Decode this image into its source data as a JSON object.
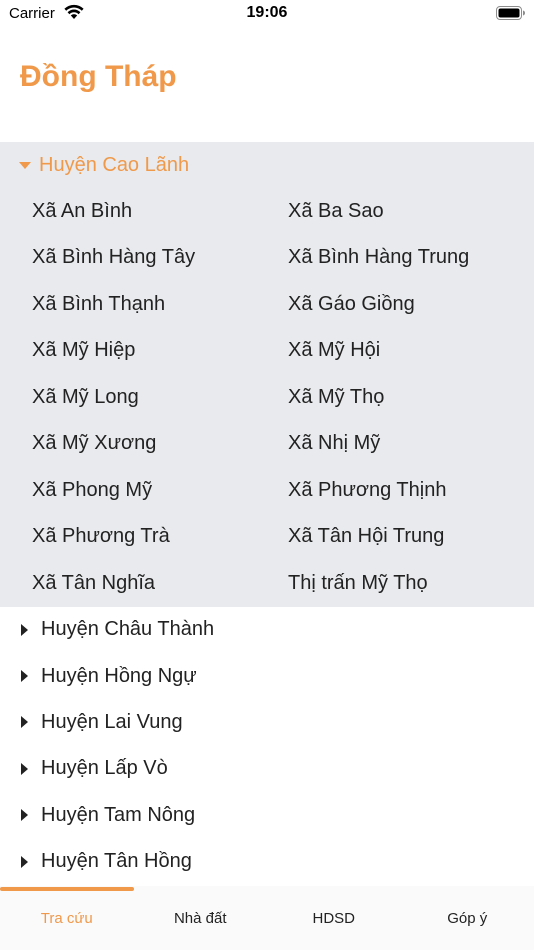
{
  "status_bar": {
    "carrier": "Carrier",
    "time": "19:06"
  },
  "page_title": "Đồng Tháp",
  "expanded_district": {
    "name": "Huyện Cao Lãnh",
    "communes": [
      "Xã An Bình",
      "Xã Ba Sao",
      "Xã Bình Hàng Tây",
      "Xã Bình Hàng Trung",
      "Xã Bình Thạnh",
      "Xã Gáo Giồng",
      "Xã Mỹ Hiệp",
      "Xã Mỹ Hội",
      "Xã Mỹ Long",
      "Xã Mỹ Thọ",
      "Xã Mỹ Xương",
      "Xã Nhị Mỹ",
      "Xã Phong Mỹ",
      "Xã Phương Thịnh",
      "Xã Phương Trà",
      "Xã Tân Hội Trung",
      "Xã Tân Nghĩa",
      "Thị trấn Mỹ Thọ"
    ]
  },
  "collapsed_districts": [
    "Huyện Châu Thành",
    "Huyện Hồng Ngự",
    "Huyện Lai Vung",
    "Huyện Lấp Vò",
    "Huyện Tam Nông",
    "Huyện Tân Hồng"
  ],
  "tabs": [
    {
      "label": "Tra cứu",
      "active": true
    },
    {
      "label": "Nhà đất",
      "active": false
    },
    {
      "label": "HDSD",
      "active": false
    },
    {
      "label": "Góp ý",
      "active": false
    }
  ],
  "colors": {
    "accent": "#F0994A",
    "expanded_bg": "#E8EAED"
  }
}
